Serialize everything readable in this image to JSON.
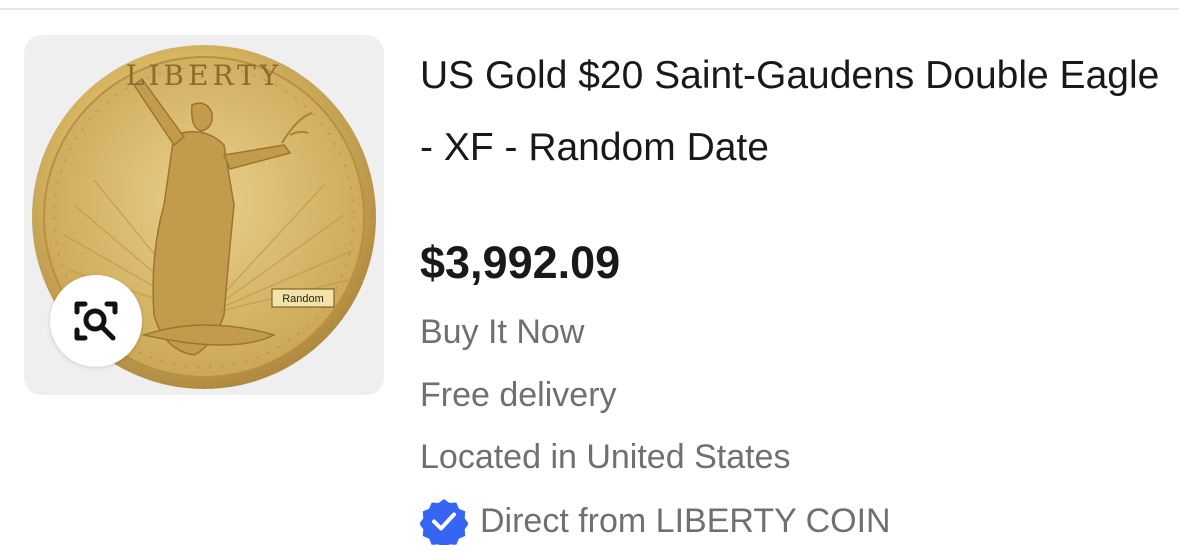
{
  "listing": {
    "title": "US Gold $20 Saint-Gaudens Double Eagle - XF - Random Date",
    "price": "$3,992.09",
    "buying_format": "Buy It Now",
    "delivery": "Free delivery",
    "location": "Located in United States",
    "seller": "Direct from LIBERTY COIN",
    "image": {
      "coin_inscription": "LIBERTY",
      "tag_label": "Random"
    }
  },
  "icons": {
    "visual_search": "visual-search-icon",
    "verified": "verified-badge-icon"
  },
  "colors": {
    "text_primary": "#191919",
    "text_secondary": "#707070",
    "verified_blue": "#3665f3",
    "thumb_bg": "#efefef",
    "coin_gold": "#d9b865"
  }
}
